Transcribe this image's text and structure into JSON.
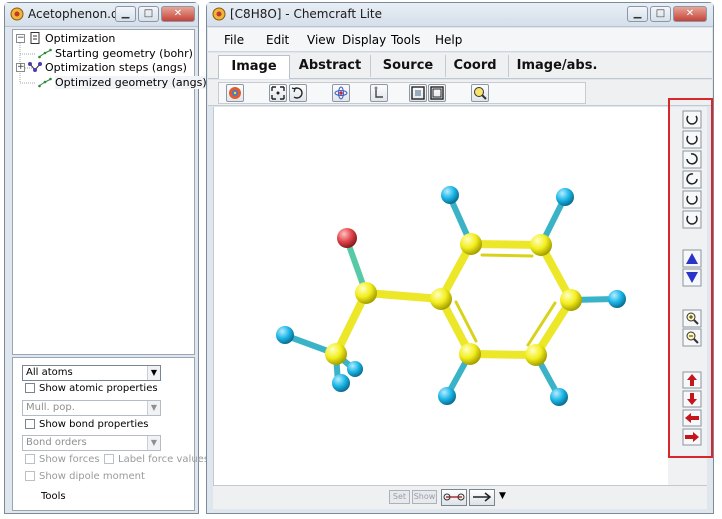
{
  "left_window": {
    "title": "Acetophenon.out",
    "tree": {
      "root": "Optimization",
      "children": [
        "Starting geometry (bohr)",
        "Optimization steps (angs)",
        "Optimized geometry (angs)"
      ]
    },
    "controls": {
      "atoms_select": "All atoms",
      "show_atomic_properties": "Show atomic properties",
      "atomic_prop_select": "Mull. pop.",
      "show_bond_properties": "Show bond properties",
      "bond_prop_select": "Bond orders",
      "show_forces": "Show forces",
      "label_force_values": "Label force values",
      "show_dipole_moment": "Show dipole moment",
      "tools": "Tools"
    }
  },
  "main_window": {
    "title": "[C8H8O] - Chemcraft Lite",
    "menu": [
      "File",
      "Edit",
      "View",
      "Display",
      "Tools",
      "Help"
    ],
    "tabs": [
      "Image",
      "Abstract",
      "Source",
      "Coord",
      "Image/abs."
    ],
    "active_tab": "Image",
    "status_buttons": [
      "Set",
      "Show"
    ]
  },
  "icons": {
    "minimize": "minimize-icon",
    "maximize": "maximize-icon",
    "close": "close-icon"
  },
  "colors": {
    "carbon": "#f2ee1c",
    "hydrogen": "#1bb7e8",
    "oxygen": "#e0464b",
    "highlight": "#d9262b",
    "arrow_blue": "#2b34c8",
    "arrow_red": "#c4161c"
  }
}
